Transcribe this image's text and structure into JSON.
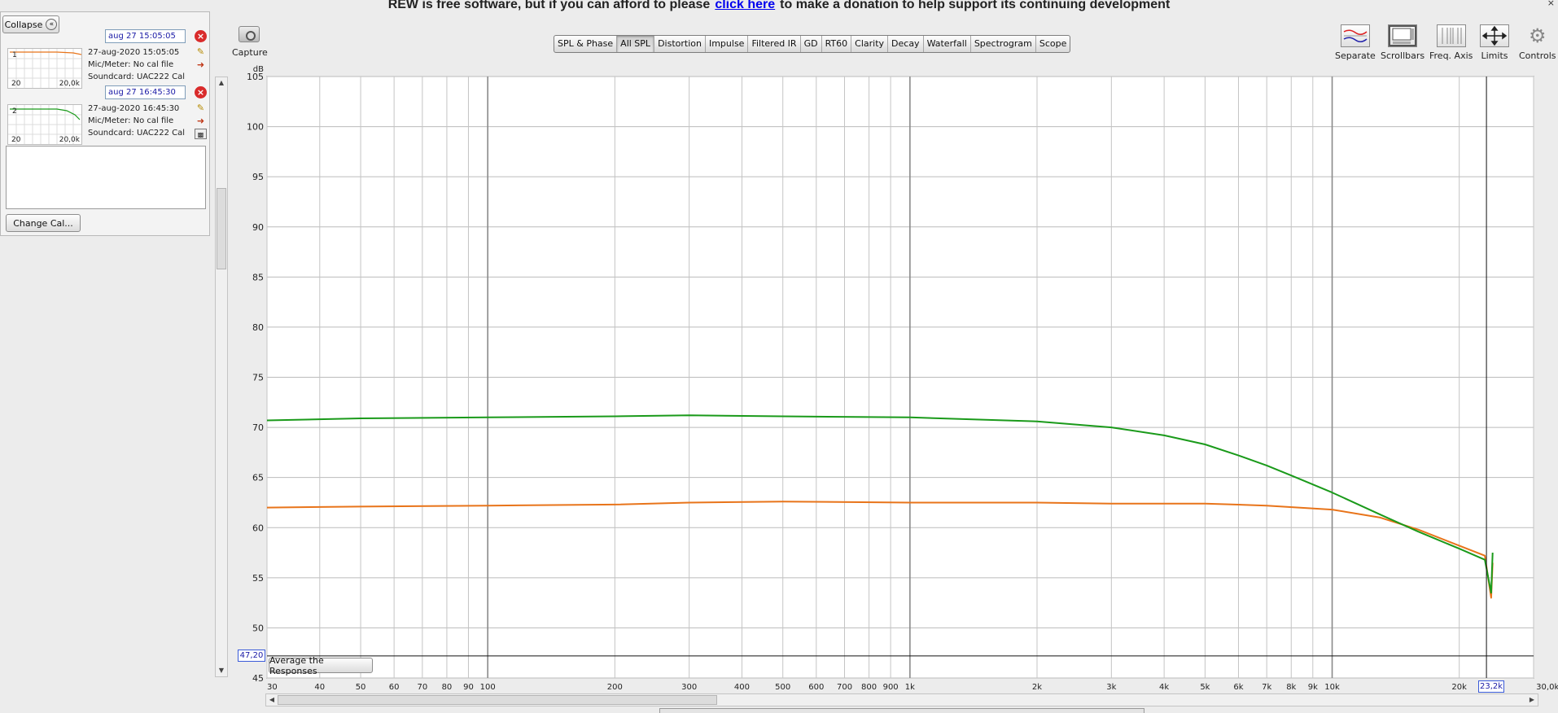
{
  "banner": {
    "text_before": "REW is free software, but if you can afford to please",
    "link_text": "click here",
    "text_after": "to make a donation to help support its continuing development",
    "close_glyph": "×"
  },
  "left_panel": {
    "collapse_label": "Collapse",
    "collapse_icon": "chevrons-left-icon",
    "change_cal_label": "Change Cal...",
    "measurements": [
      {
        "index": "1",
        "name": "aug 27 15:05:05",
        "date": "27-aug-2020 15:05:05",
        "mic": "Mic/Meter: No cal file",
        "soundcard": "Soundcard: UAC222 Cal",
        "thumb_left": "20",
        "thumb_right": "20,0k",
        "color": "#e8741a"
      },
      {
        "index": "2",
        "name": "aug 27 16:45:30",
        "date": "27-aug-2020 16:45:30",
        "mic": "Mic/Meter: No cal file",
        "soundcard": "Soundcard: UAC222 Cal",
        "thumb_left": "20",
        "thumb_right": "20,0k",
        "color": "#1a9a1a"
      }
    ]
  },
  "capture": {
    "label": "Capture",
    "icon": "camera-icon"
  },
  "tabs": [
    {
      "label": "SPL & Phase",
      "active": false
    },
    {
      "label": "All SPL",
      "active": true
    },
    {
      "label": "Distortion",
      "active": false
    },
    {
      "label": "Impulse",
      "active": false
    },
    {
      "label": "Filtered IR",
      "active": false
    },
    {
      "label": "GD",
      "active": false
    },
    {
      "label": "RT60",
      "active": false
    },
    {
      "label": "Clarity",
      "active": false
    },
    {
      "label": "Decay",
      "active": false
    },
    {
      "label": "Waterfall",
      "active": false
    },
    {
      "label": "Spectrogram",
      "active": false
    },
    {
      "label": "Scope",
      "active": false
    }
  ],
  "right_toolbar": [
    {
      "label": "Separate",
      "icon": "separate-icon"
    },
    {
      "label": "Scrollbars",
      "icon": "scrollbars-icon"
    },
    {
      "label": "Freq. Axis",
      "icon": "freq-axis-icon"
    },
    {
      "label": "Limits",
      "icon": "limits-icon"
    },
    {
      "label": "Controls",
      "icon": "gear-icon"
    }
  ],
  "graph": {
    "average_button_label": "Average the Responses",
    "cursor_y_value": "47,20",
    "cursor_x_value": "23,2k"
  },
  "chart_data": {
    "type": "line",
    "x_scale": "log",
    "xlim": [
      30,
      30000
    ],
    "ylim": [
      45,
      105
    ],
    "ylabel": "dB",
    "xlabel": "",
    "y_ticks": [
      45,
      50,
      55,
      60,
      65,
      70,
      75,
      80,
      85,
      90,
      95,
      100,
      105
    ],
    "x_ticks": [
      {
        "v": 30,
        "label": "30"
      },
      {
        "v": 40,
        "label": "40"
      },
      {
        "v": 50,
        "label": "50"
      },
      {
        "v": 60,
        "label": "60"
      },
      {
        "v": 70,
        "label": "70"
      },
      {
        "v": 80,
        "label": "80"
      },
      {
        "v": 90,
        "label": "90"
      },
      {
        "v": 100,
        "label": "100"
      },
      {
        "v": 200,
        "label": "200"
      },
      {
        "v": 300,
        "label": "300"
      },
      {
        "v": 400,
        "label": "400"
      },
      {
        "v": 500,
        "label": "500"
      },
      {
        "v": 600,
        "label": "600"
      },
      {
        "v": 700,
        "label": "700"
      },
      {
        "v": 800,
        "label": "800"
      },
      {
        "v": 900,
        "label": "900"
      },
      {
        "v": 1000,
        "label": "1k"
      },
      {
        "v": 2000,
        "label": "2k"
      },
      {
        "v": 3000,
        "label": "3k"
      },
      {
        "v": 4000,
        "label": "4k"
      },
      {
        "v": 5000,
        "label": "5k"
      },
      {
        "v": 6000,
        "label": "6k"
      },
      {
        "v": 7000,
        "label": "7k"
      },
      {
        "v": 8000,
        "label": "8k"
      },
      {
        "v": 9000,
        "label": "9k"
      },
      {
        "v": 10000,
        "label": "10k"
      },
      {
        "v": 20000,
        "label": "20k"
      },
      {
        "v": 30000,
        "label": "30,0kHz"
      }
    ],
    "cursor": {
      "x": 23200,
      "y": 47.2
    },
    "grid": true,
    "series": [
      {
        "color": "#e8741a",
        "x": [
          30,
          50,
          100,
          200,
          300,
          500,
          1000,
          2000,
          3000,
          5000,
          7000,
          10000,
          13000,
          16000,
          20000,
          23000,
          23800,
          24000
        ],
        "values": [
          62.0,
          62.1,
          62.2,
          62.3,
          62.5,
          62.6,
          62.5,
          62.5,
          62.4,
          62.4,
          62.2,
          61.8,
          61.0,
          59.8,
          58.2,
          57.2,
          53.0,
          56.5
        ]
      },
      {
        "color": "#1a9a1a",
        "x": [
          30,
          50,
          100,
          200,
          300,
          500,
          1000,
          2000,
          3000,
          4000,
          5000,
          6000,
          7000,
          8000,
          10000,
          13000,
          16000,
          20000,
          23000,
          23800,
          24000
        ],
        "values": [
          70.7,
          70.9,
          71.0,
          71.1,
          71.2,
          71.1,
          71.0,
          70.6,
          70.0,
          69.2,
          68.3,
          67.2,
          66.2,
          65.2,
          63.5,
          61.3,
          59.6,
          57.9,
          56.8,
          53.5,
          57.5
        ]
      }
    ]
  }
}
